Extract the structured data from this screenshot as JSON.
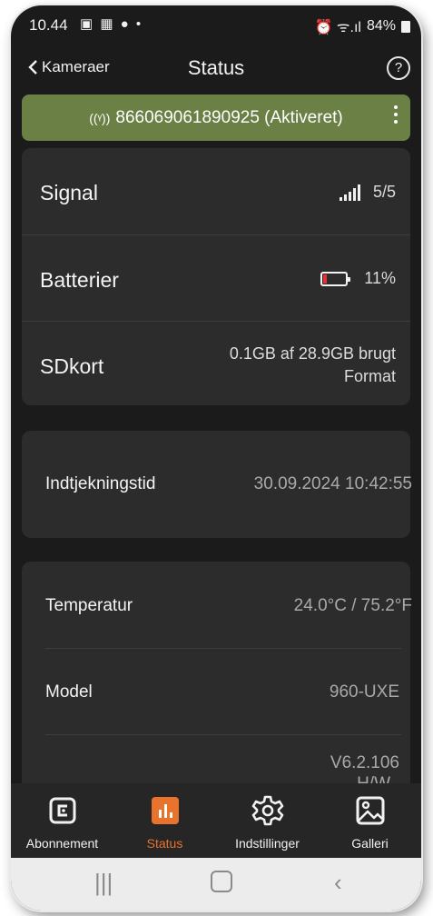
{
  "status_bar": {
    "time": "10.44",
    "left_icons": "▣ ▦ ● •",
    "right_icons": "⏰ ᯤ.ıl",
    "battery": "84%"
  },
  "nav": {
    "back_label": "Kameraer",
    "title": "Status",
    "help_label": "?"
  },
  "device": {
    "icon": "((ᵞ))",
    "label": "866069061890925 (Aktiveret)"
  },
  "card1": {
    "signal_label": "Signal",
    "signal_value": "5/5",
    "signal_level": 5,
    "battery_label": "Batterier",
    "battery_value": "11%",
    "battery_level": 0.11,
    "sd_label": "SDkort",
    "sd_value": "0.1GB af 28.9GB brugt",
    "sd_action": "Format"
  },
  "card2": {
    "checkin_label": "Indtjekningstid",
    "checkin_value": "30.09.2024 10:42:55"
  },
  "card3": {
    "temp_label": "Temperatur",
    "temp_value": "24.0°C / 75.2°F",
    "model_label": "Model",
    "model_value": "960-UXE",
    "version_line1": "V6.2.106",
    "version_line2": "H/W"
  },
  "tabs": [
    {
      "label": "Abonnement",
      "icon": "wallet-icon"
    },
    {
      "label": "Status",
      "icon": "bar-chart-icon"
    },
    {
      "label": "Indstillinger",
      "icon": "gear-icon"
    },
    {
      "label": "Galleri",
      "icon": "image-icon"
    }
  ],
  "colors": {
    "accent": "#e8732c",
    "device_bar": "#6b8045",
    "battery_low": "#e03535"
  }
}
